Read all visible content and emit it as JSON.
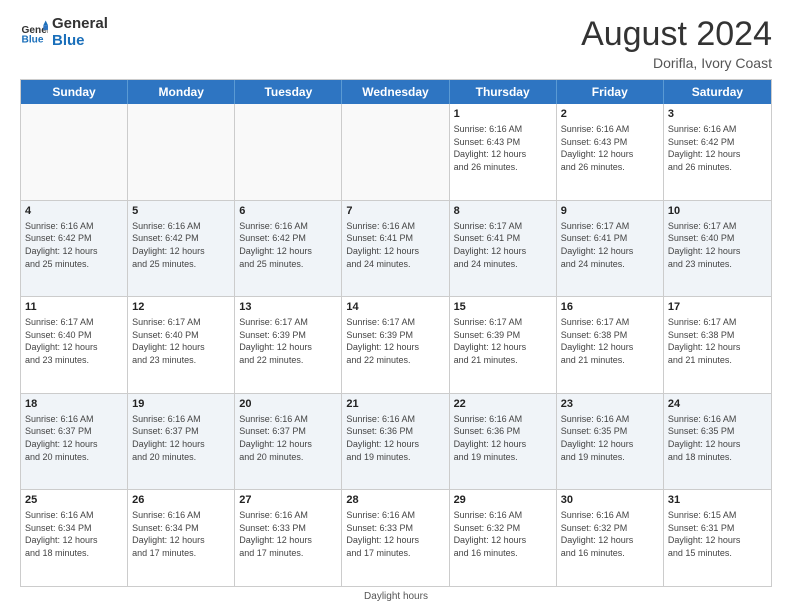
{
  "logo": {
    "text_general": "General",
    "text_blue": "Blue"
  },
  "header": {
    "title": "August 2024",
    "subtitle": "Dorifla, Ivory Coast"
  },
  "calendar": {
    "days": [
      "Sunday",
      "Monday",
      "Tuesday",
      "Wednesday",
      "Thursday",
      "Friday",
      "Saturday"
    ],
    "footer": "Daylight hours"
  },
  "weeks": [
    [
      {
        "day": "",
        "info": ""
      },
      {
        "day": "",
        "info": ""
      },
      {
        "day": "",
        "info": ""
      },
      {
        "day": "",
        "info": ""
      },
      {
        "day": "1",
        "info": "Sunrise: 6:16 AM\nSunset: 6:43 PM\nDaylight: 12 hours\nand 26 minutes."
      },
      {
        "day": "2",
        "info": "Sunrise: 6:16 AM\nSunset: 6:43 PM\nDaylight: 12 hours\nand 26 minutes."
      },
      {
        "day": "3",
        "info": "Sunrise: 6:16 AM\nSunset: 6:42 PM\nDaylight: 12 hours\nand 26 minutes."
      }
    ],
    [
      {
        "day": "4",
        "info": "Sunrise: 6:16 AM\nSunset: 6:42 PM\nDaylight: 12 hours\nand 25 minutes."
      },
      {
        "day": "5",
        "info": "Sunrise: 6:16 AM\nSunset: 6:42 PM\nDaylight: 12 hours\nand 25 minutes."
      },
      {
        "day": "6",
        "info": "Sunrise: 6:16 AM\nSunset: 6:42 PM\nDaylight: 12 hours\nand 25 minutes."
      },
      {
        "day": "7",
        "info": "Sunrise: 6:16 AM\nSunset: 6:41 PM\nDaylight: 12 hours\nand 24 minutes."
      },
      {
        "day": "8",
        "info": "Sunrise: 6:17 AM\nSunset: 6:41 PM\nDaylight: 12 hours\nand 24 minutes."
      },
      {
        "day": "9",
        "info": "Sunrise: 6:17 AM\nSunset: 6:41 PM\nDaylight: 12 hours\nand 24 minutes."
      },
      {
        "day": "10",
        "info": "Sunrise: 6:17 AM\nSunset: 6:40 PM\nDaylight: 12 hours\nand 23 minutes."
      }
    ],
    [
      {
        "day": "11",
        "info": "Sunrise: 6:17 AM\nSunset: 6:40 PM\nDaylight: 12 hours\nand 23 minutes."
      },
      {
        "day": "12",
        "info": "Sunrise: 6:17 AM\nSunset: 6:40 PM\nDaylight: 12 hours\nand 23 minutes."
      },
      {
        "day": "13",
        "info": "Sunrise: 6:17 AM\nSunset: 6:39 PM\nDaylight: 12 hours\nand 22 minutes."
      },
      {
        "day": "14",
        "info": "Sunrise: 6:17 AM\nSunset: 6:39 PM\nDaylight: 12 hours\nand 22 minutes."
      },
      {
        "day": "15",
        "info": "Sunrise: 6:17 AM\nSunset: 6:39 PM\nDaylight: 12 hours\nand 21 minutes."
      },
      {
        "day": "16",
        "info": "Sunrise: 6:17 AM\nSunset: 6:38 PM\nDaylight: 12 hours\nand 21 minutes."
      },
      {
        "day": "17",
        "info": "Sunrise: 6:17 AM\nSunset: 6:38 PM\nDaylight: 12 hours\nand 21 minutes."
      }
    ],
    [
      {
        "day": "18",
        "info": "Sunrise: 6:16 AM\nSunset: 6:37 PM\nDaylight: 12 hours\nand 20 minutes."
      },
      {
        "day": "19",
        "info": "Sunrise: 6:16 AM\nSunset: 6:37 PM\nDaylight: 12 hours\nand 20 minutes."
      },
      {
        "day": "20",
        "info": "Sunrise: 6:16 AM\nSunset: 6:37 PM\nDaylight: 12 hours\nand 20 minutes."
      },
      {
        "day": "21",
        "info": "Sunrise: 6:16 AM\nSunset: 6:36 PM\nDaylight: 12 hours\nand 19 minutes."
      },
      {
        "day": "22",
        "info": "Sunrise: 6:16 AM\nSunset: 6:36 PM\nDaylight: 12 hours\nand 19 minutes."
      },
      {
        "day": "23",
        "info": "Sunrise: 6:16 AM\nSunset: 6:35 PM\nDaylight: 12 hours\nand 19 minutes."
      },
      {
        "day": "24",
        "info": "Sunrise: 6:16 AM\nSunset: 6:35 PM\nDaylight: 12 hours\nand 18 minutes."
      }
    ],
    [
      {
        "day": "25",
        "info": "Sunrise: 6:16 AM\nSunset: 6:34 PM\nDaylight: 12 hours\nand 18 minutes."
      },
      {
        "day": "26",
        "info": "Sunrise: 6:16 AM\nSunset: 6:34 PM\nDaylight: 12 hours\nand 17 minutes."
      },
      {
        "day": "27",
        "info": "Sunrise: 6:16 AM\nSunset: 6:33 PM\nDaylight: 12 hours\nand 17 minutes."
      },
      {
        "day": "28",
        "info": "Sunrise: 6:16 AM\nSunset: 6:33 PM\nDaylight: 12 hours\nand 17 minutes."
      },
      {
        "day": "29",
        "info": "Sunrise: 6:16 AM\nSunset: 6:32 PM\nDaylight: 12 hours\nand 16 minutes."
      },
      {
        "day": "30",
        "info": "Sunrise: 6:16 AM\nSunset: 6:32 PM\nDaylight: 12 hours\nand 16 minutes."
      },
      {
        "day": "31",
        "info": "Sunrise: 6:15 AM\nSunset: 6:31 PM\nDaylight: 12 hours\nand 15 minutes."
      }
    ]
  ]
}
